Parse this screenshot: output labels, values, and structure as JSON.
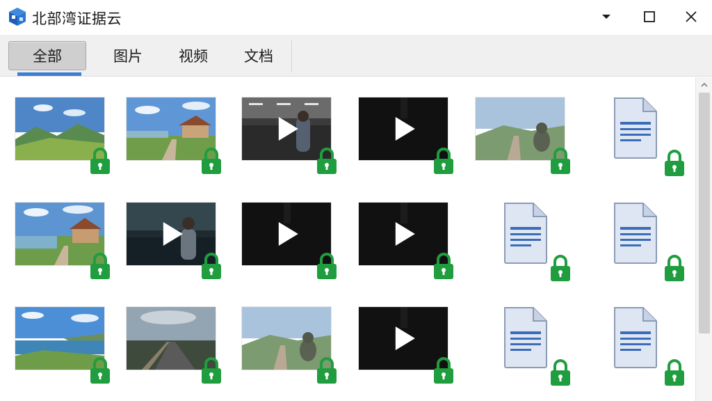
{
  "window": {
    "title": "北部湾证据云"
  },
  "tabs": [
    {
      "label": "全部",
      "active": true
    },
    {
      "label": "图片",
      "active": false
    },
    {
      "label": "视频",
      "active": false
    },
    {
      "label": "文档",
      "active": false
    }
  ],
  "items": [
    {
      "type": "image",
      "scene": "hills",
      "locked": true
    },
    {
      "type": "image",
      "scene": "cabin",
      "locked": true
    },
    {
      "type": "video",
      "scene": "office",
      "locked": true
    },
    {
      "type": "video",
      "scene": "dark",
      "locked": true
    },
    {
      "type": "image",
      "scene": "faded-trail",
      "locked": true
    },
    {
      "type": "document",
      "locked": true
    },
    {
      "type": "image",
      "scene": "cabin-lake",
      "locked": true
    },
    {
      "type": "video",
      "scene": "seaside-person",
      "locked": true
    },
    {
      "type": "video",
      "scene": "dark",
      "locked": true
    },
    {
      "type": "video",
      "scene": "dark",
      "locked": true
    },
    {
      "type": "document",
      "locked": true
    },
    {
      "type": "document",
      "locked": true
    },
    {
      "type": "image",
      "scene": "coast",
      "locked": true
    },
    {
      "type": "image",
      "scene": "road-dusk",
      "locked": true
    },
    {
      "type": "image",
      "scene": "faded-trail",
      "locked": true
    },
    {
      "type": "video",
      "scene": "dark",
      "locked": true
    },
    {
      "type": "document",
      "locked": true
    },
    {
      "type": "document",
      "locked": true
    }
  ],
  "colors": {
    "accent": "#3b7fd4",
    "lock": "#1f9d3f",
    "tab_active_bg": "#cfcfcf"
  }
}
